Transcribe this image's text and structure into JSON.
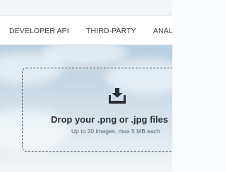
{
  "nav": {
    "items": [
      {
        "label": "DEVELOPER API"
      },
      {
        "label": "THIRD-PARTY"
      },
      {
        "label": "ANAL"
      }
    ]
  },
  "dropzone": {
    "title": "Drop your .png or .jpg files",
    "subtitle": "Up to 20 images, max 5 MB each",
    "icon": "upload-tray-icon"
  },
  "colors": {
    "nav_text": "#3a3f45",
    "dropzone_border": "#4d5560",
    "icon": "#2b3036"
  }
}
